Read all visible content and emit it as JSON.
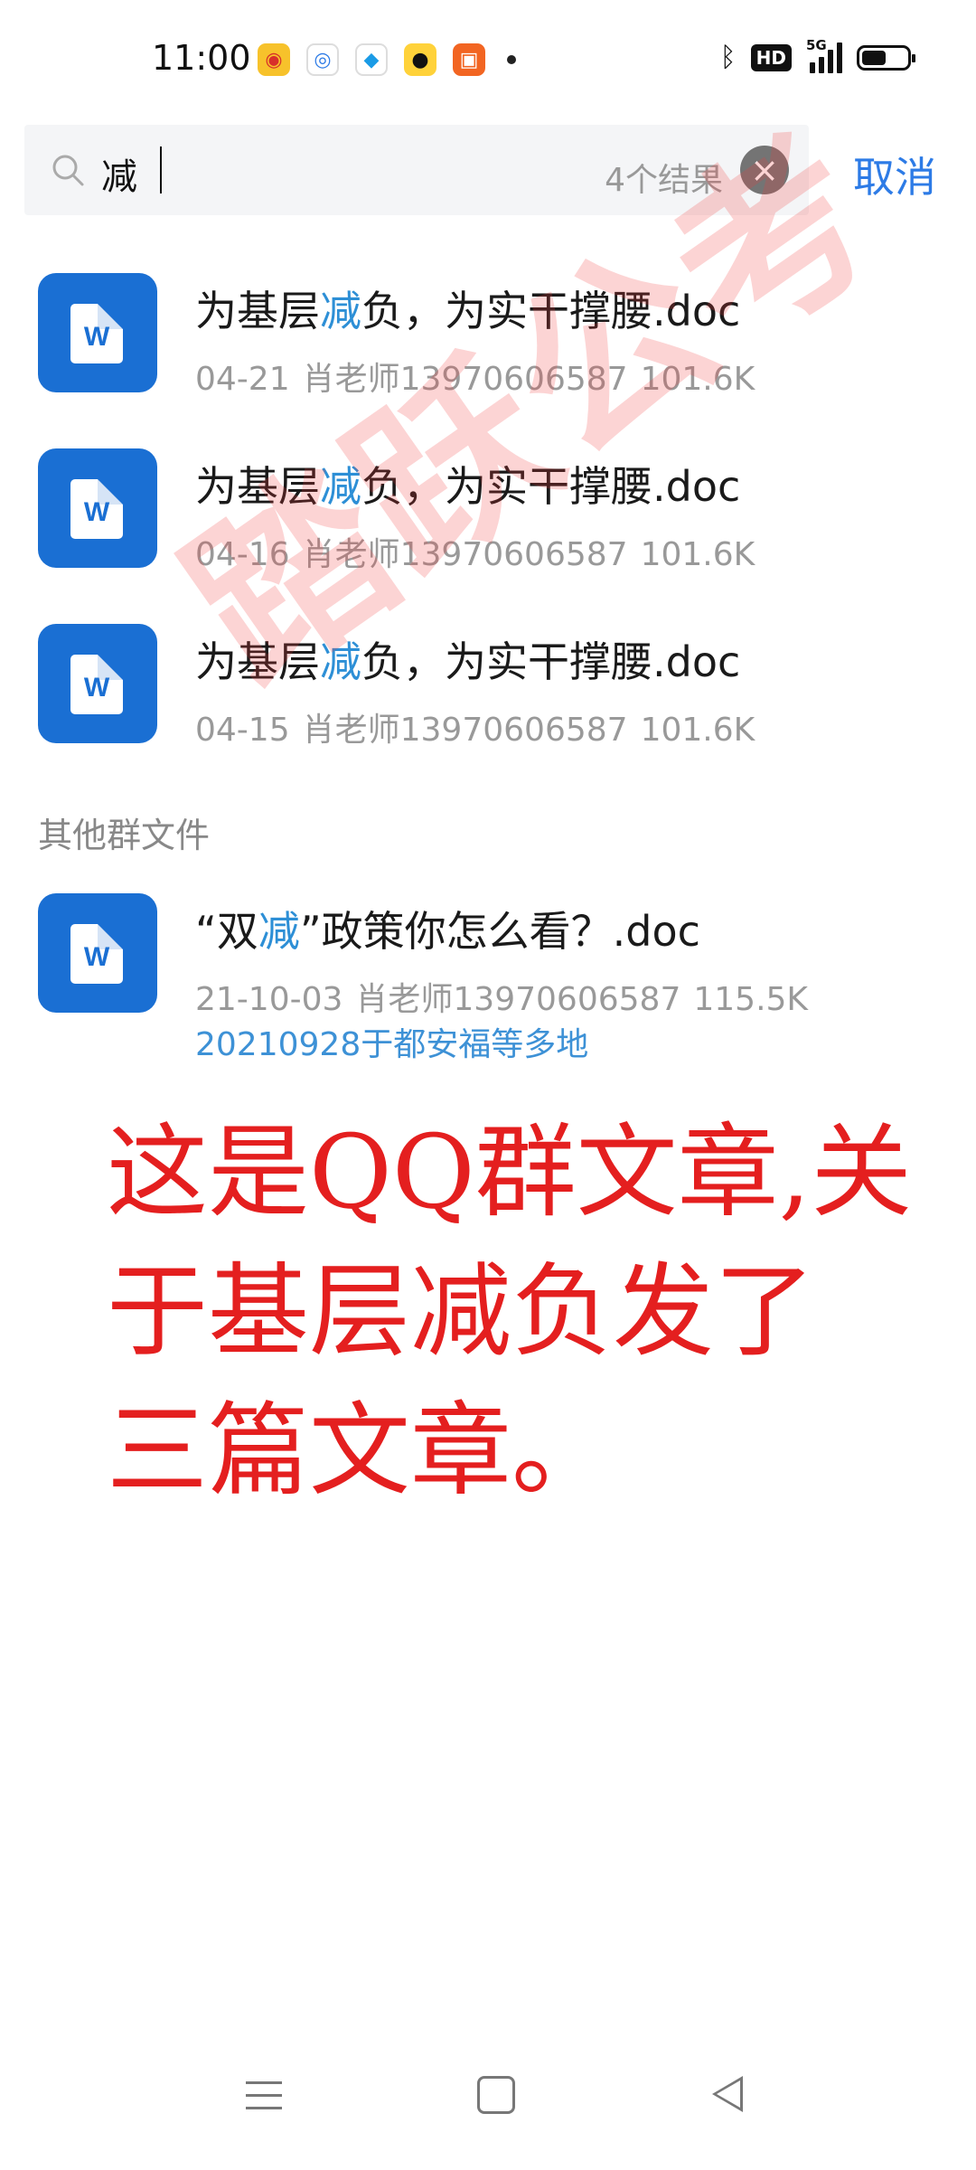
{
  "status_bar": {
    "time": "11:00",
    "app_icons": [
      "weibo-icon",
      "browser-icon",
      "map-icon",
      "pet-app-icon",
      "store-app-icon"
    ],
    "network_label": "5G",
    "hd_label": "HD",
    "battery_level": 0.55
  },
  "search": {
    "query": "减",
    "result_count": "4个结果",
    "cancel_label": "取消"
  },
  "results": [
    {
      "title_pre": "为基层",
      "title_hl": "减",
      "title_post": "负，为实干撑腰.doc",
      "date": "04-21",
      "sender": "肖老师13970606587",
      "size": "101.6K"
    },
    {
      "title_pre": "为基层",
      "title_hl": "减",
      "title_post": "负，为实干撑腰.doc",
      "date": "04-16",
      "sender": "肖老师13970606587",
      "size": "101.6K"
    },
    {
      "title_pre": "为基层",
      "title_hl": "减",
      "title_post": "负，为实干撑腰.doc",
      "date": "04-15",
      "sender": "肖老师13970606587",
      "size": "101.6K"
    }
  ],
  "other_section": {
    "header": "其他群文件",
    "items": [
      {
        "title_pre": "“双",
        "title_hl": "减",
        "title_post": "”政策你怎么看？.doc",
        "date": "21-10-03",
        "sender": "肖老师13970606587",
        "size": "115.5K",
        "group": "20210928于都安福等多地"
      }
    ]
  },
  "watermark": "踏跃公考",
  "annotation": {
    "line1": "这是QQ群文章,关",
    "line2": "于基层减负发了",
    "line3": "三篇文章。"
  },
  "colors": {
    "accent": "#2d7be6",
    "highlight": "#2d8fd6",
    "word_blue": "#1a6fd3",
    "annotation_red": "#e41f1f"
  }
}
